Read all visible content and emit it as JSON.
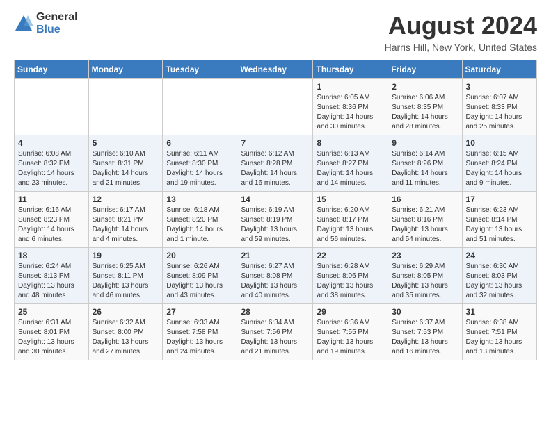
{
  "header": {
    "logo_general": "General",
    "logo_blue": "Blue",
    "title": "August 2024",
    "subtitle": "Harris Hill, New York, United States"
  },
  "days_of_week": [
    "Sunday",
    "Monday",
    "Tuesday",
    "Wednesday",
    "Thursday",
    "Friday",
    "Saturday"
  ],
  "weeks": [
    [
      {
        "day": "",
        "info": ""
      },
      {
        "day": "",
        "info": ""
      },
      {
        "day": "",
        "info": ""
      },
      {
        "day": "",
        "info": ""
      },
      {
        "day": "1",
        "info": "Sunrise: 6:05 AM\nSunset: 8:36 PM\nDaylight: 14 hours\nand 30 minutes."
      },
      {
        "day": "2",
        "info": "Sunrise: 6:06 AM\nSunset: 8:35 PM\nDaylight: 14 hours\nand 28 minutes."
      },
      {
        "day": "3",
        "info": "Sunrise: 6:07 AM\nSunset: 8:33 PM\nDaylight: 14 hours\nand 25 minutes."
      }
    ],
    [
      {
        "day": "4",
        "info": "Sunrise: 6:08 AM\nSunset: 8:32 PM\nDaylight: 14 hours\nand 23 minutes."
      },
      {
        "day": "5",
        "info": "Sunrise: 6:10 AM\nSunset: 8:31 PM\nDaylight: 14 hours\nand 21 minutes."
      },
      {
        "day": "6",
        "info": "Sunrise: 6:11 AM\nSunset: 8:30 PM\nDaylight: 14 hours\nand 19 minutes."
      },
      {
        "day": "7",
        "info": "Sunrise: 6:12 AM\nSunset: 8:28 PM\nDaylight: 14 hours\nand 16 minutes."
      },
      {
        "day": "8",
        "info": "Sunrise: 6:13 AM\nSunset: 8:27 PM\nDaylight: 14 hours\nand 14 minutes."
      },
      {
        "day": "9",
        "info": "Sunrise: 6:14 AM\nSunset: 8:26 PM\nDaylight: 14 hours\nand 11 minutes."
      },
      {
        "day": "10",
        "info": "Sunrise: 6:15 AM\nSunset: 8:24 PM\nDaylight: 14 hours\nand 9 minutes."
      }
    ],
    [
      {
        "day": "11",
        "info": "Sunrise: 6:16 AM\nSunset: 8:23 PM\nDaylight: 14 hours\nand 6 minutes."
      },
      {
        "day": "12",
        "info": "Sunrise: 6:17 AM\nSunset: 8:21 PM\nDaylight: 14 hours\nand 4 minutes."
      },
      {
        "day": "13",
        "info": "Sunrise: 6:18 AM\nSunset: 8:20 PM\nDaylight: 14 hours\nand 1 minute."
      },
      {
        "day": "14",
        "info": "Sunrise: 6:19 AM\nSunset: 8:19 PM\nDaylight: 13 hours\nand 59 minutes."
      },
      {
        "day": "15",
        "info": "Sunrise: 6:20 AM\nSunset: 8:17 PM\nDaylight: 13 hours\nand 56 minutes."
      },
      {
        "day": "16",
        "info": "Sunrise: 6:21 AM\nSunset: 8:16 PM\nDaylight: 13 hours\nand 54 minutes."
      },
      {
        "day": "17",
        "info": "Sunrise: 6:23 AM\nSunset: 8:14 PM\nDaylight: 13 hours\nand 51 minutes."
      }
    ],
    [
      {
        "day": "18",
        "info": "Sunrise: 6:24 AM\nSunset: 8:13 PM\nDaylight: 13 hours\nand 48 minutes."
      },
      {
        "day": "19",
        "info": "Sunrise: 6:25 AM\nSunset: 8:11 PM\nDaylight: 13 hours\nand 46 minutes."
      },
      {
        "day": "20",
        "info": "Sunrise: 6:26 AM\nSunset: 8:09 PM\nDaylight: 13 hours\nand 43 minutes."
      },
      {
        "day": "21",
        "info": "Sunrise: 6:27 AM\nSunset: 8:08 PM\nDaylight: 13 hours\nand 40 minutes."
      },
      {
        "day": "22",
        "info": "Sunrise: 6:28 AM\nSunset: 8:06 PM\nDaylight: 13 hours\nand 38 minutes."
      },
      {
        "day": "23",
        "info": "Sunrise: 6:29 AM\nSunset: 8:05 PM\nDaylight: 13 hours\nand 35 minutes."
      },
      {
        "day": "24",
        "info": "Sunrise: 6:30 AM\nSunset: 8:03 PM\nDaylight: 13 hours\nand 32 minutes."
      }
    ],
    [
      {
        "day": "25",
        "info": "Sunrise: 6:31 AM\nSunset: 8:01 PM\nDaylight: 13 hours\nand 30 minutes."
      },
      {
        "day": "26",
        "info": "Sunrise: 6:32 AM\nSunset: 8:00 PM\nDaylight: 13 hours\nand 27 minutes."
      },
      {
        "day": "27",
        "info": "Sunrise: 6:33 AM\nSunset: 7:58 PM\nDaylight: 13 hours\nand 24 minutes."
      },
      {
        "day": "28",
        "info": "Sunrise: 6:34 AM\nSunset: 7:56 PM\nDaylight: 13 hours\nand 21 minutes."
      },
      {
        "day": "29",
        "info": "Sunrise: 6:36 AM\nSunset: 7:55 PM\nDaylight: 13 hours\nand 19 minutes."
      },
      {
        "day": "30",
        "info": "Sunrise: 6:37 AM\nSunset: 7:53 PM\nDaylight: 13 hours\nand 16 minutes."
      },
      {
        "day": "31",
        "info": "Sunrise: 6:38 AM\nSunset: 7:51 PM\nDaylight: 13 hours\nand 13 minutes."
      }
    ]
  ]
}
